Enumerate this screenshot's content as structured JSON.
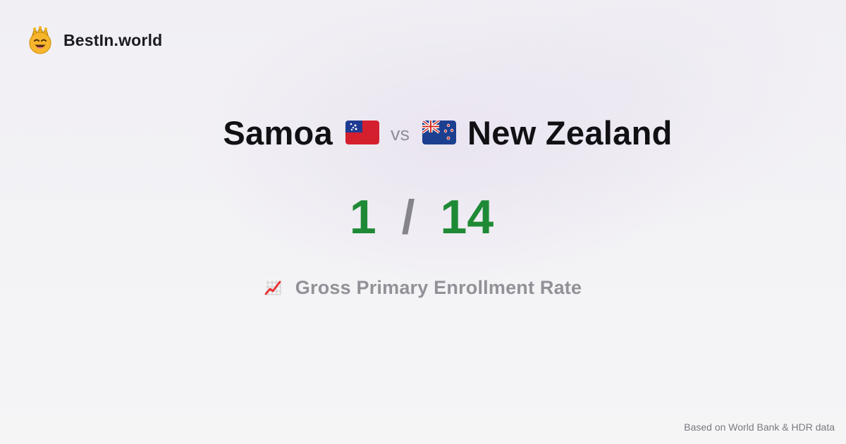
{
  "brand": {
    "name": "BestIn.world",
    "logo_icon": "crowned-smiley-icon"
  },
  "comparison": {
    "left_country": {
      "name": "Samoa",
      "flag_icon": "samoa-flag-icon"
    },
    "separator": "vs",
    "right_country": {
      "name": "New Zealand",
      "flag_icon": "new-zealand-flag-icon"
    }
  },
  "ranks": {
    "left": "1",
    "separator": "/",
    "right": "14",
    "color": "#1f8a36"
  },
  "metric": {
    "icon": "chart-increasing-icon",
    "label": "Gross Primary Enrollment Rate"
  },
  "footer": {
    "source": "Based on World Bank & HDR data"
  }
}
